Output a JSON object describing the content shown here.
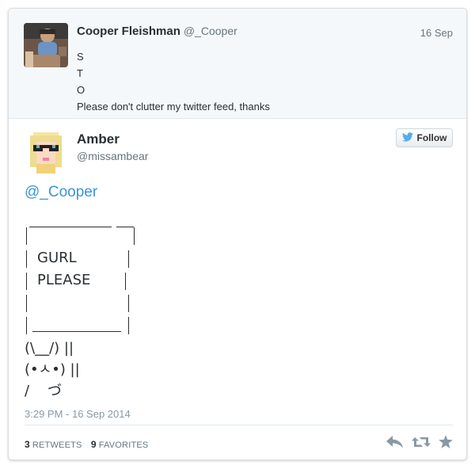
{
  "parent_tweet": {
    "name": "Cooper Fleishman",
    "handle": "@_Cooper",
    "date": "16 Sep",
    "lines": [
      "S",
      "T",
      "O",
      "Please don't clutter my twitter feed, thanks"
    ]
  },
  "tweet": {
    "name": "Amber",
    "handle": "@missambear",
    "follow_label": "Follow",
    "mention": "@_Cooper",
    "ascii": {
      "gurl": "GURL",
      "please": "PLEASE",
      "arms": "(\\__/) ||",
      "face": "(•ㅅ•) ||",
      "feet": "/    づ"
    },
    "timestamp": "3:29 PM - 16 Sep 2014",
    "retweets_count": "3",
    "retweets_label": "RETWEETS",
    "favorites_count": "9",
    "favorites_label": "FAVORITES"
  },
  "colors": {
    "link": "#3b94d9",
    "twitter_blue": "#55acee",
    "icon_gray": "#8899a6"
  }
}
